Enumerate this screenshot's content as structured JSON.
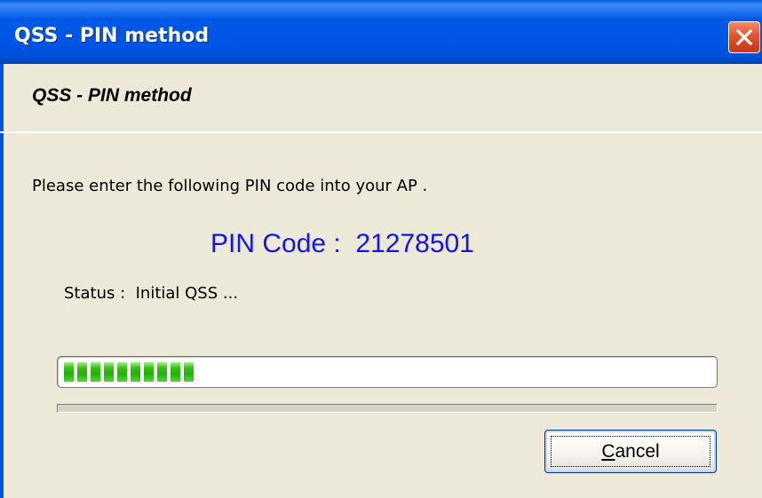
{
  "window": {
    "title": "QSS - PIN method"
  },
  "header": {
    "label": "QSS - PIN method"
  },
  "body": {
    "instruction": "Please enter the following PIN code into your AP .",
    "pin_label": "PIN Code :",
    "pin_value": "21278501",
    "status_label": "Status :",
    "status_value": "Initial QSS ..."
  },
  "progress": {
    "filled_blocks": 10,
    "total_blocks": 49,
    "fraction": 0.2
  },
  "buttons": {
    "cancel_accel": "C",
    "cancel_rest": "ancel"
  },
  "colors": {
    "pin_text": "#1414e6",
    "progress_fill": "#22b00a",
    "titlebar": "#0055e5",
    "close_button": "#e0502a"
  },
  "icons": {
    "close": "close-icon"
  }
}
